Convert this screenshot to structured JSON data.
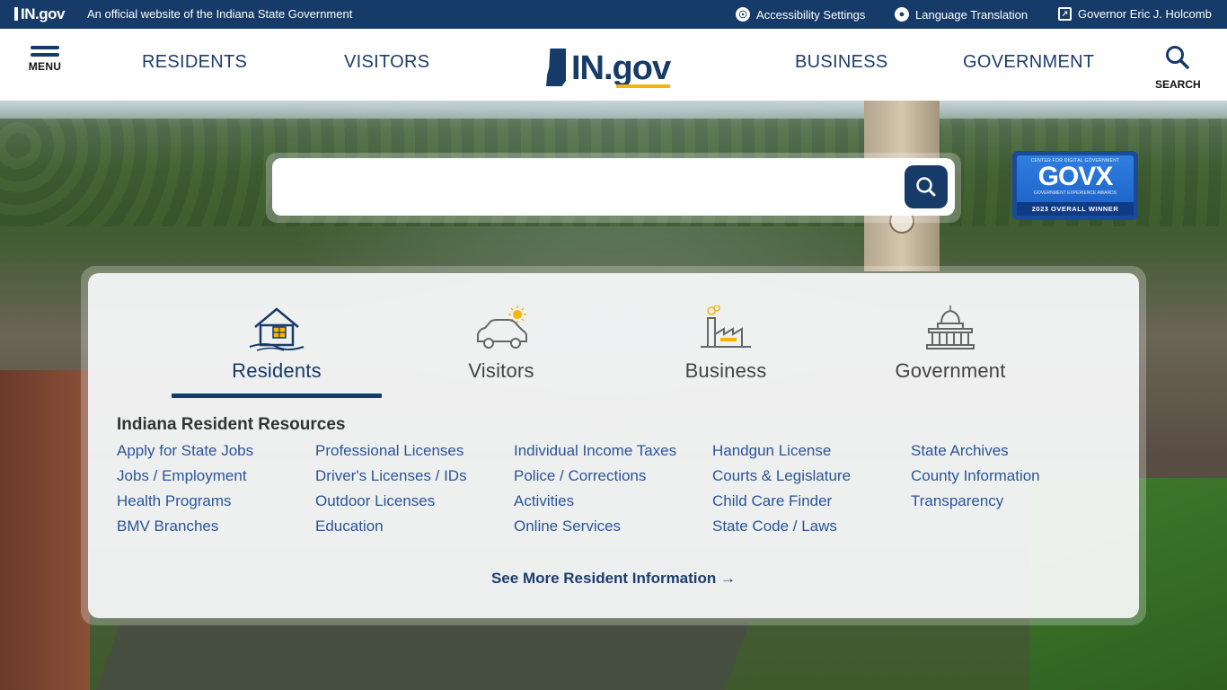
{
  "topbar": {
    "logo_text": "IN.gov",
    "official_text": "An official website of the Indiana State Government",
    "links": [
      {
        "label": "Accessibility Settings",
        "icon": "accessibility-icon"
      },
      {
        "label": "Language Translation",
        "icon": "globe-icon"
      },
      {
        "label": "Governor Eric J. Holcomb",
        "icon": "external-link-icon"
      }
    ]
  },
  "header": {
    "menu_label": "MENU",
    "nav": [
      "RESIDENTS",
      "VISITORS",
      "BUSINESS",
      "GOVERNMENT"
    ],
    "brand": "IN.gov",
    "search_label": "SEARCH"
  },
  "search": {
    "value": "",
    "placeholder": ""
  },
  "award": {
    "small": "CENTER FOR DIGITAL GOVERNMENT",
    "big": "GOVX",
    "sub": "GOVERNMENT EXPERIENCE AWARDS",
    "winner": "2023 OVERALL WINNER"
  },
  "tabs": [
    {
      "label": "Residents",
      "icon": "house-icon",
      "active": true
    },
    {
      "label": "Visitors",
      "icon": "car-sun-icon",
      "active": false
    },
    {
      "label": "Business",
      "icon": "factory-icon",
      "active": false
    },
    {
      "label": "Government",
      "icon": "capitol-icon",
      "active": false
    }
  ],
  "resources": {
    "title": "Indiana Resident Resources",
    "columns": [
      [
        "Apply for State Jobs",
        "Jobs / Employment",
        "Health Programs",
        "BMV Branches"
      ],
      [
        "Professional Licenses",
        "Driver's Licenses / IDs",
        "Outdoor Licenses",
        "Education"
      ],
      [
        "Individual Income Taxes",
        "Police / Corrections",
        "Activities",
        "Online Services"
      ],
      [
        "Handgun License",
        "Courts & Legislature",
        "Child Care Finder",
        "State Code / Laws"
      ],
      [
        "State Archives",
        "County Information",
        "Transparency"
      ]
    ],
    "see_more": "See More Resident Information →"
  },
  "colors": {
    "navy": "#163b69",
    "link": "#2a5599",
    "accent": "#f2b705"
  }
}
